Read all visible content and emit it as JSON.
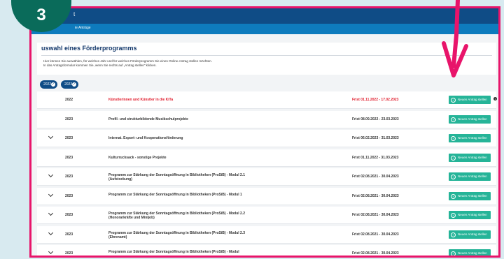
{
  "step_badge": "3",
  "header": {
    "title": "t",
    "breadcrumb": "ie Anträge"
  },
  "panel": {
    "title": "uswahl eines Förderprogramms",
    "line1": "Hier können Sie auswählen, für welches Jahr und für welches Förderprogramm Sie einen Online-Antrag stellen möchten.",
    "line2": "In das Antragsformular kommen Sie, wenn Sie rechts auf „Antrag stellen\" klicken."
  },
  "filters": [
    "2022",
    "2023"
  ],
  "button_label": "Neuen Antrag stellen",
  "colors": {
    "accent": "#e8146a",
    "primary": "#0f4c86",
    "button": "#25b498",
    "deadline_red": "#e01a2a"
  },
  "rows": [
    {
      "year": "2022",
      "program": "Künstlerinnen und Künstler in die KiTa",
      "deadline": "Frist 01.11.2022 - 17.02.2023",
      "expandable": false,
      "highlight": true,
      "info": true
    },
    {
      "year": "2023",
      "program": "Profil- und strukturbildende Musikschulprojekte",
      "deadline": "Frist 08.09.2022 - 23.03.2023",
      "expandable": false,
      "highlight": false
    },
    {
      "year": "2023",
      "program": "Internat. Export- und Kooperationsförderung",
      "deadline": "Frist 06.02.2023 - 31.03.2023",
      "expandable": true,
      "highlight": false
    },
    {
      "year": "2023",
      "program": "Kulturrucksack - sonstige Projekte",
      "deadline": "Frist 01.11.2022 - 31.03.2023",
      "expandable": false,
      "highlight": false
    },
    {
      "year": "2023",
      "program": "Programm zur Stärkung der Sonntagsöffnung in Bibliotheken (ProSiB) - Modul 2.1 (Aufstockung)",
      "deadline": "Frist 02.08.2021 - 30.04.2023",
      "expandable": true,
      "highlight": false
    },
    {
      "year": "2023",
      "program": "Programm zur Stärkung der Sonntagsöffnung in Bibliotheken (ProSiB) - Modul 1",
      "deadline": "Frist 02.08.2021 - 30.04.2023",
      "expandable": true,
      "highlight": false
    },
    {
      "year": "2023",
      "program": "Programm zur Stärkung der Sonntagsöffnung in Bibliotheken (ProSiB) - Modul 2.2 (Honorarkräfte und Minijob)",
      "deadline": "Frist 02.08.2021 - 30.04.2023",
      "expandable": true,
      "highlight": false
    },
    {
      "year": "2023",
      "program": "Programm zur Stärkung der Sonntagsöffnung in Bibliotheken (ProSiB) - Modul 2.3 (Ehrenamt)",
      "deadline": "Frist 02.08.2021 - 30.04.2023",
      "expandable": true,
      "highlight": false
    },
    {
      "year": "2023",
      "program": "Programm zur Stärkung der Sonntagsöffnung in Bibliotheken (ProSiB) - Modul",
      "deadline": "Frist 02.08.2021 - 30.04.2023",
      "expandable": true,
      "highlight": false
    }
  ]
}
